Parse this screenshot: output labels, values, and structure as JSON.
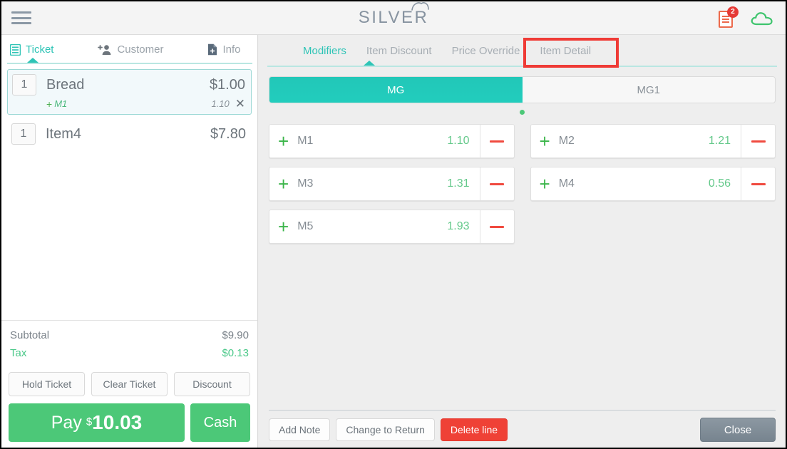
{
  "header": {
    "menu_icon": "hamburger-icon",
    "logo_text": "SILVER",
    "logo_mark": "cloud-arc",
    "receipt_icon": "receipt-icon",
    "receipt_badge": "2",
    "cloud_icon": "cloud-icon"
  },
  "left_panel": {
    "tabs": [
      {
        "label": "Ticket",
        "icon": "ticket-icon",
        "active": true
      },
      {
        "label": "Customer",
        "icon": "add-person-icon",
        "active": false
      },
      {
        "label": "Info",
        "icon": "document-add-icon",
        "active": false
      }
    ],
    "items": [
      {
        "qty": "1",
        "name": "Bread",
        "price": "$1.00",
        "selected": true,
        "modifier": {
          "plus": "+",
          "name": "M1",
          "price": "1.10",
          "remove": "✕"
        }
      },
      {
        "qty": "1",
        "name": "Item4",
        "price": "$7.80",
        "selected": false
      }
    ],
    "totals": [
      {
        "label": "Subtotal",
        "value": "$9.90",
        "kind": "subtotal"
      },
      {
        "label": "Tax",
        "value": "$0.13",
        "kind": "tax"
      }
    ],
    "actions": [
      {
        "label": "Hold Ticket"
      },
      {
        "label": "Clear Ticket"
      },
      {
        "label": "Discount"
      }
    ],
    "pay": {
      "word": "Pay",
      "currency": "$",
      "amount": "10.03",
      "cash_label": "Cash"
    }
  },
  "right_panel": {
    "tabs": [
      {
        "label": "Modifiers",
        "active": true,
        "highlighted": false
      },
      {
        "label": "Item Discount",
        "active": false,
        "highlighted": false
      },
      {
        "label": "Price Override",
        "active": false,
        "highlighted": true
      },
      {
        "label": "Item Detail",
        "active": false,
        "highlighted": false
      }
    ],
    "modifier_groups": [
      {
        "label": "MG",
        "active": true
      },
      {
        "label": "MG1",
        "active": false
      }
    ],
    "page_dots": 1,
    "modifiers": [
      {
        "plus": "+",
        "name": "M1",
        "price": "1.10",
        "remove": "minus-icon"
      },
      {
        "plus": "+",
        "name": "M2",
        "price": "1.21",
        "remove": "minus-icon"
      },
      {
        "plus": "+",
        "name": "M3",
        "price": "1.31",
        "remove": "minus-icon"
      },
      {
        "plus": "+",
        "name": "M4",
        "price": "0.56",
        "remove": "minus-icon"
      },
      {
        "plus": "+",
        "name": "M5",
        "price": "1.93",
        "remove": "minus-icon"
      }
    ],
    "bottom_actions": [
      {
        "label": "Add Note",
        "style": "light"
      },
      {
        "label": "Change to Return",
        "style": "light"
      },
      {
        "label": "Delete line",
        "style": "danger"
      }
    ],
    "close_label": "Close"
  },
  "colors": {
    "accent_teal": "#2ec4b6",
    "green": "#4cc878",
    "red": "#ef4136",
    "annotation_red": "#ef3b36",
    "gray_text": "#6d757c",
    "orange": "#ec6a4c"
  }
}
